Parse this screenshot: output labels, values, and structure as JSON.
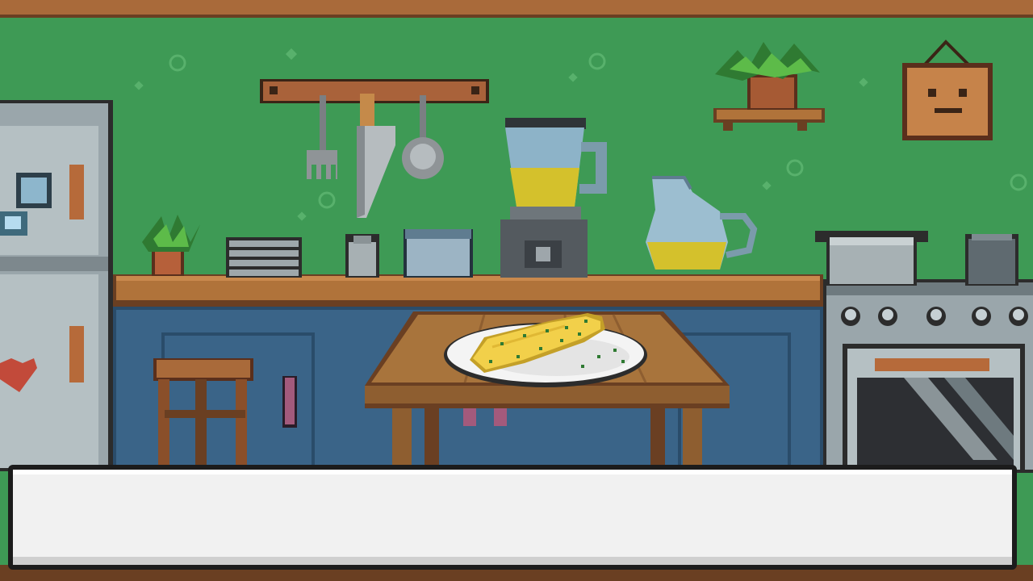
{
  "scene": {
    "name": "kitchen",
    "focus_item": "omelette-on-plate"
  },
  "dialog": {
    "text": ""
  },
  "colors": {
    "wall": "#3e9a55",
    "counter_top": "#b0733a",
    "cabinet": "#3a6488",
    "table_top": "#a8743c",
    "omelette": "#f2d04a",
    "dialog_bg": "#f1f1f1",
    "dialog_border": "#1c1c1c"
  },
  "icons": [
    "fridge-icon",
    "utensil-rack-icon",
    "blender-icon",
    "pitcher-icon",
    "potted-plant-icon",
    "smiley-frame-icon",
    "stove-icon",
    "table-icon",
    "omelette-plate-icon",
    "stool-icon"
  ]
}
